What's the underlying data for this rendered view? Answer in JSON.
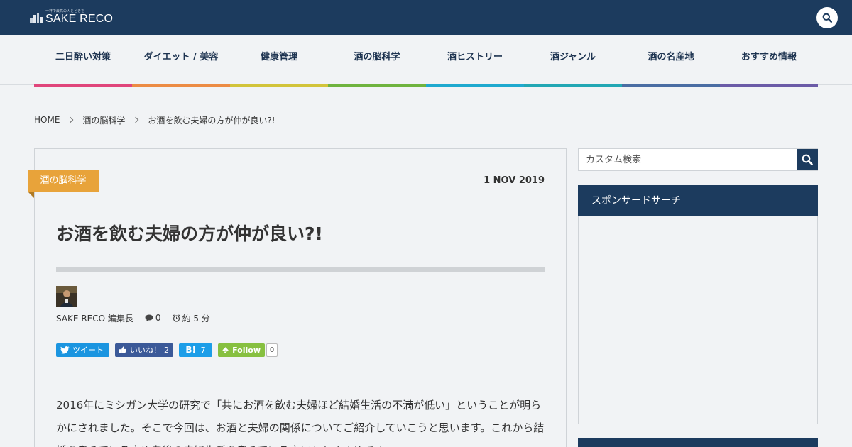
{
  "header": {
    "logo_text": "SAKE RECO",
    "logo_tagline": "一杯で最高の人とときを",
    "search_icon": "search-icon"
  },
  "nav": {
    "items": [
      {
        "label": "二日酔い対策",
        "color": "#e0457b"
      },
      {
        "label": "ダイエット / 美容",
        "color": "#ec8b44"
      },
      {
        "label": "健康管理",
        "color": "#d2c43a"
      },
      {
        "label": "酒の脳科学",
        "color": "#6fb33e"
      },
      {
        "label": "酒ヒストリー",
        "color": "#1fa9cf"
      },
      {
        "label": "酒ジャンル",
        "color": "#22a7b4"
      },
      {
        "label": "酒の名産地",
        "color": "#4a6da3"
      },
      {
        "label": "おすすめ情報",
        "color": "#6b5ba7"
      }
    ]
  },
  "breadcrumb": {
    "home": "HOME",
    "category": "酒の脳科学",
    "current": "お酒を飲む夫婦の方が仲が良い?!"
  },
  "article": {
    "category": "酒の脳科学",
    "date": "1 NOV 2019",
    "title": "お酒を飲む夫婦の方が仲が良い?!",
    "author": "SAKE RECO 編集長",
    "comments": "0",
    "read_time": "約 5 分",
    "share": {
      "tweet": "ツイート",
      "like": "いいね！",
      "like_count": "2",
      "hatena": "B!",
      "hatena_count": "7",
      "follow": "Follow",
      "follow_count": "0"
    },
    "body": "2016年にミシガン大学の研究で「共にお酒を飲む夫婦ほど結婚生活の不満が低い」ということが明らかにされました。そこで今回は、お酒と夫婦の関係についてご紹介していこうと思います。これから結婚を考えている方や老後の夫婦生活を考えている方にもおすすめです。"
  },
  "sidebar": {
    "search_placeholder": "カスタム検索",
    "widget_title": "スポンサードサーチ"
  },
  "colors": {
    "primary": "#1c3b5e",
    "category": "#e8a33a",
    "background": "#f1f3f5"
  }
}
